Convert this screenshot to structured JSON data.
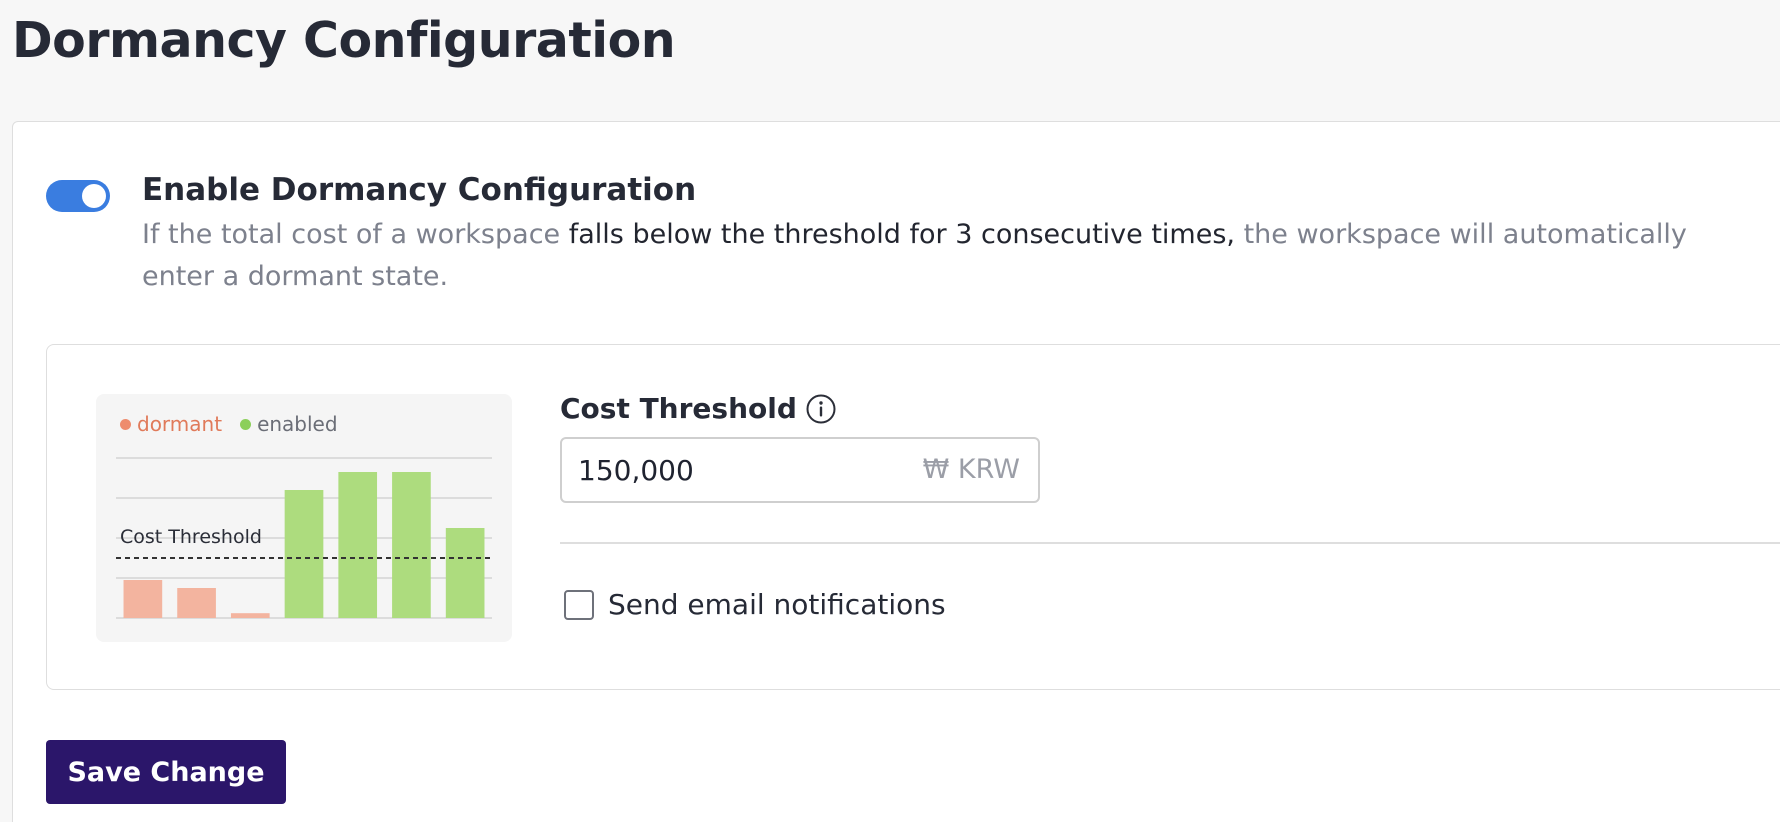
{
  "page": {
    "title": "Dormancy Configuration"
  },
  "dormancy": {
    "enabled": true,
    "title": "Enable Dormancy Configuration",
    "description_pre": "If the total cost of a workspace ",
    "description_strong": "falls below the threshold for 3 consecutive times,",
    "description_post": " the workspace will automatically enter a dormant state."
  },
  "chart_data": {
    "type": "bar",
    "legend": [
      {
        "label": "dormant",
        "color": "#ee8c6e"
      },
      {
        "label": "enabled",
        "color": "#8ccf5a"
      }
    ],
    "threshold_label": "Cost Threshold",
    "threshold_value": 1.5,
    "ylim": [
      0,
      4
    ],
    "gridlines": [
      0,
      1,
      2,
      3,
      4
    ],
    "values": [
      0.95,
      0.75,
      0.12,
      3.2,
      3.65,
      3.65,
      2.25
    ],
    "status": [
      "dormant",
      "dormant",
      "dormant",
      "enabled",
      "enabled",
      "enabled",
      "enabled"
    ],
    "colors": {
      "dormant": "#f3b49f",
      "enabled": "#addc7e",
      "grid": "#dcdcdc",
      "threshold": "#333333"
    }
  },
  "cost_threshold": {
    "label": "Cost Threshold",
    "value": "150,000",
    "suffix": "₩ KRW"
  },
  "email_notifications": {
    "label": "Send email notifications",
    "checked": false
  },
  "actions": {
    "save_label": "Save Change"
  },
  "colors": {
    "primary": "#2b166a",
    "toggle": "#3a7de0"
  }
}
